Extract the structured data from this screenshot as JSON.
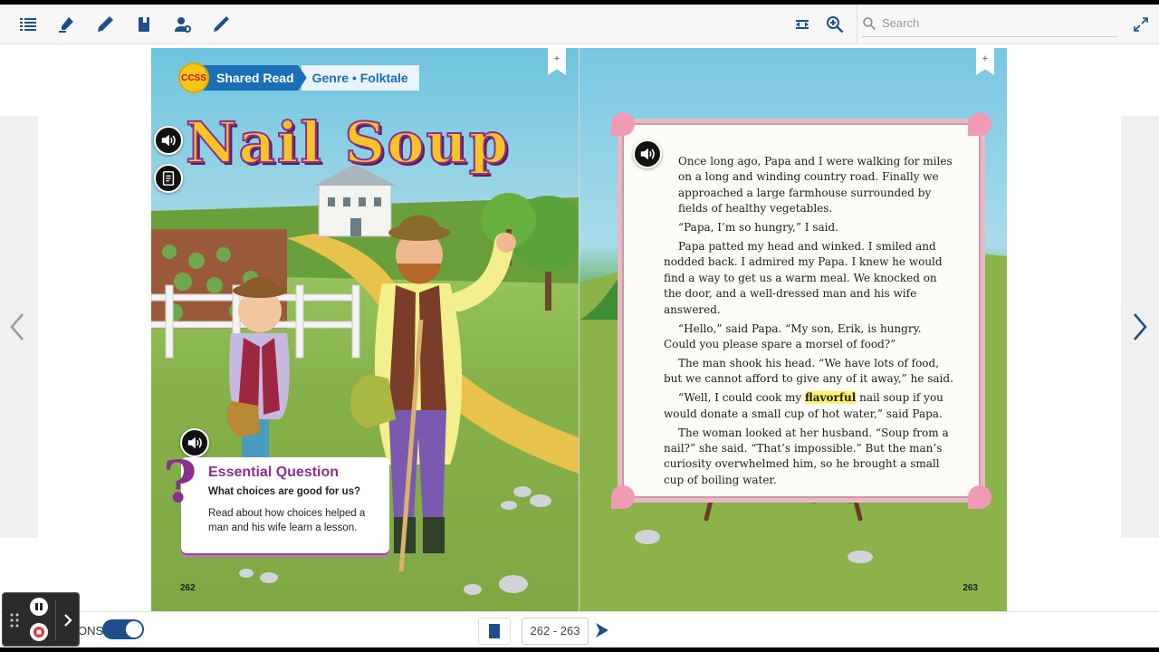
{
  "toolbar": {
    "search_placeholder": "Search"
  },
  "page_left": {
    "badge": "CCSS",
    "shared_read": "Shared Read",
    "genre": "Genre • Folktale",
    "title": "Nail Soup",
    "eq_title": "Essential Question",
    "eq_subtitle": "What choices are good for us?",
    "eq_body": "Read about how choices helped a man and his wife learn a lesson.",
    "page_number": "262",
    "bookmark": "+"
  },
  "page_right": {
    "page_number": "263",
    "bookmark": "+",
    "story": {
      "p1": "Once long ago, Papa and I were walking for miles on a long and winding country road. Finally we approached a large farmhouse surrounded by fields of healthy vegetables.",
      "p2": "“Papa, I’m so hungry,” I said.",
      "p3": "Papa patted my head and winked. I smiled and nodded back. I admired my Papa. I knew he would find a way to get us a warm meal. We knocked on the door, and a well-dressed man and his wife answered.",
      "p4": "“Hello,” said Papa. “My son, Erik, is hungry. Could you please spare a morsel of food?”",
      "p5": "The man shook his head. “We have lots of food, but we cannot afford to give any of it away,” he said.",
      "p6_before": "“Well, I could cook my ",
      "p6_highlight": "flavorful",
      "p6_after": " nail soup if you would donate a small cup of hot water,” said Papa.",
      "p7": "The woman looked at her husband. “Soup from a nail?” she said. “That’s impossible.” But the man’s curiosity overwhelmed him, so he brought a small cup of boiling water."
    }
  },
  "bottom_bar": {
    "options_label": "ONS:",
    "page_range": "262 - 263"
  },
  "colors": {
    "accent": "#1f4f8a",
    "title_gold": "#f7c325",
    "purple": "#8b2f8f",
    "highlight": "#fff36a"
  }
}
